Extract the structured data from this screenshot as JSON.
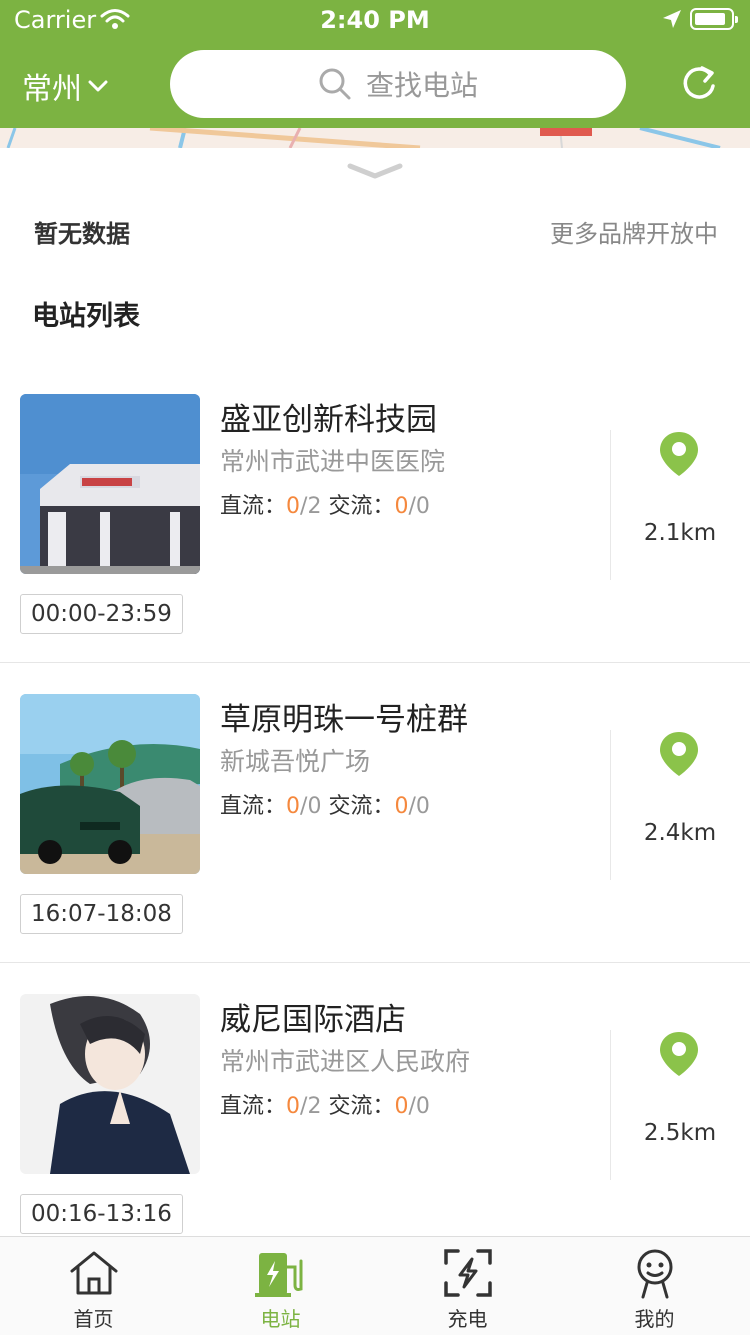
{
  "status_bar": {
    "carrier": "Carrier",
    "time": "2:40 PM"
  },
  "header": {
    "city": "常州",
    "search_placeholder": "查找电站",
    "accent_color": "#7cb342"
  },
  "summary": {
    "no_data": "暂无数据",
    "more_brands": "更多品牌开放中"
  },
  "list_title": "电站列表",
  "labels": {
    "dc": "直流：",
    "ac": "交流：",
    "sep": "/"
  },
  "stations": [
    {
      "name": "盛亚创新科技园",
      "address": "常州市武进中医医院",
      "dc_available": "0",
      "dc_total": "2",
      "ac_available": "0",
      "ac_total": "0",
      "distance": "2.1km",
      "hours": "00:00-23:59",
      "thumb": "storefront-photo"
    },
    {
      "name": "草原明珠一号桩群",
      "address": "新城吾悦广场",
      "dc_available": "0",
      "dc_total": "0",
      "ac_available": "0",
      "ac_total": "0",
      "distance": "2.4km",
      "hours": "16:07-18:08",
      "thumb": "car-photo"
    },
    {
      "name": "威尼国际酒店",
      "address": "常州市武进区人民政府",
      "dc_available": "0",
      "dc_total": "2",
      "ac_available": "0",
      "ac_total": "0",
      "distance": "2.5km",
      "hours": "00:16-13:16",
      "thumb": "illustration-photo"
    }
  ],
  "tabs": [
    {
      "label": "首页",
      "icon": "home-icon"
    },
    {
      "label": "电站",
      "icon": "charging-station-icon",
      "active": true
    },
    {
      "label": "充电",
      "icon": "scan-charge-icon"
    },
    {
      "label": "我的",
      "icon": "profile-icon"
    }
  ]
}
